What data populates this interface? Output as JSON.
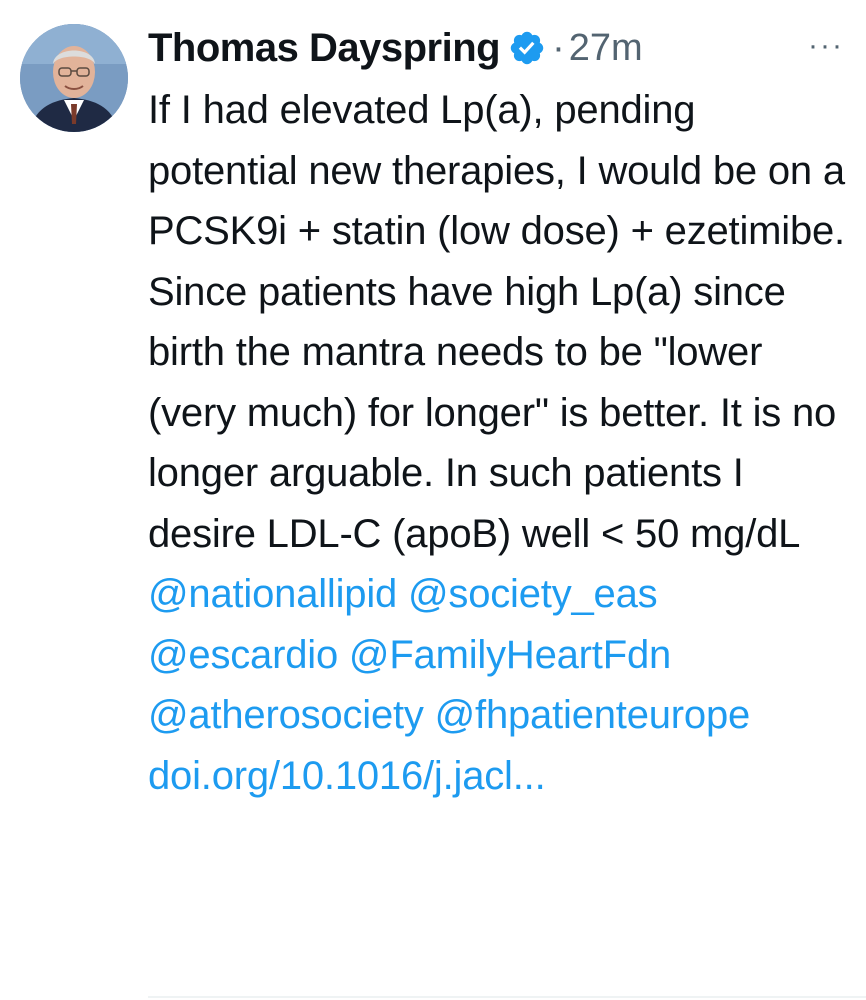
{
  "author": {
    "name": "Thomas Dayspring",
    "separator": "·",
    "time": "27m"
  },
  "icons": {
    "avatar": "avatar-photo",
    "verified": "verified-badge-icon",
    "more": "more-options-icon"
  },
  "colors": {
    "link": "#1d9bf0",
    "verified": "#1d9bf0",
    "muted": "#536471",
    "text": "#0f1419"
  },
  "tweet": {
    "text": "If I had elevated Lp(a), pending potential new therapies, I would be on a PCSK9i + statin (low dose) + ezetimibe. Since patients have high Lp(a) since birth the mantra needs to be \"lower (very much) for longer\" is better. It is no longer arguable. In such patients I desire LDL-C (apoB) well < 50 mg/dL",
    "mentions": [
      "@nationallipid",
      "@society_eas",
      "@escardio",
      "@FamilyHeartFdn",
      "@atherosociety",
      "@fhpatienteurope"
    ],
    "link_text": "doi.org/10.1016/j.jacl..."
  },
  "more_label": "···"
}
